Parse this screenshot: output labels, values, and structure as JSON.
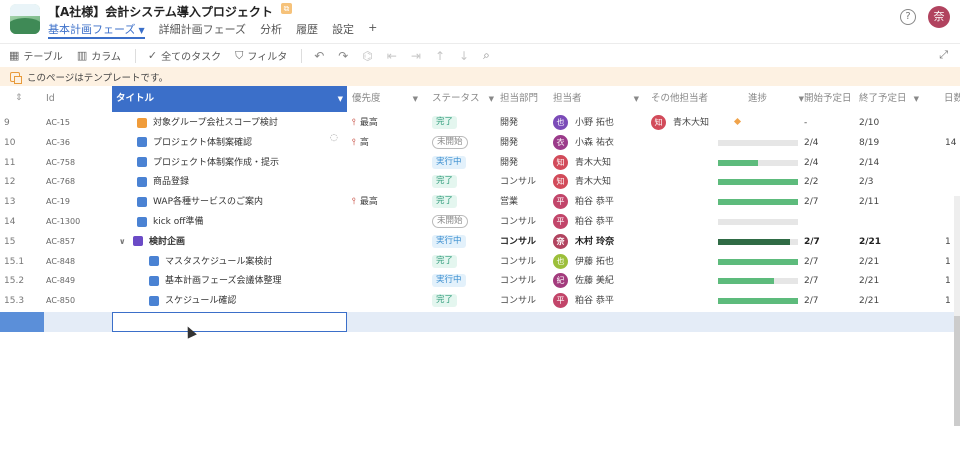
{
  "header": {
    "project_title": "【A社様】会計システム導入プロジェクト",
    "tabs": [
      {
        "label": "基本計画フェーズ",
        "active": true
      },
      {
        "label": "詳細計画フェーズ"
      },
      {
        "label": "分析"
      },
      {
        "label": "履歴"
      },
      {
        "label": "設定"
      },
      {
        "label": "+"
      }
    ],
    "help_icon": "?",
    "user_avatar": "奈"
  },
  "toolbar": {
    "table_label": "テーブル",
    "column_label": "カラム",
    "all_tasks_label": "全てのタスク",
    "filter_label": "フィルタ"
  },
  "notice": {
    "text": "このページはテンプレートです。"
  },
  "grid": {
    "columns": {
      "id": "Id",
      "title": "タイトル",
      "priority": "優先度",
      "status": "ステータス",
      "dept": "担当部門",
      "assignee": "担当者",
      "others": "その他担当者",
      "progress": "進捗",
      "start": "開始予定日",
      "end": "終了予定日",
      "days": "日数"
    },
    "rows": [
      {
        "num": "9",
        "id": "AC-15",
        "title": "対象グループ会社スコープ検討",
        "icon": "orange",
        "priority": "最高",
        "status": "完了",
        "status_type": "done",
        "dept": "開発",
        "assignee": "小野 拓也",
        "av": "也",
        "av_color": "#7b4bb8",
        "other": "青木大知",
        "other_av": "知",
        "other_color": "#d24b5a",
        "progress": null,
        "start": "-",
        "end": "2/10",
        "days": ""
      },
      {
        "num": "10",
        "id": "AC-36",
        "title": "プロジェクト体制案確認",
        "icon": "blue",
        "comment": true,
        "priority": "高",
        "status": "未開始",
        "status_type": "todo",
        "dept": "開発",
        "assignee": "小森 祐衣",
        "av": "衣",
        "av_color": "#9b3b8a",
        "progress": 0,
        "start": "2/4",
        "end": "8/19",
        "days": "14"
      },
      {
        "num": "11",
        "id": "AC-758",
        "title": "プロジェクト体制案作成・提示",
        "icon": "blue",
        "priority": "",
        "status": "実行中",
        "status_type": "prog",
        "dept": "開発",
        "assignee": "青木大知",
        "av": "知",
        "av_color": "#d24b5a",
        "progress": 0.5,
        "start": "2/4",
        "end": "2/14",
        "days": ""
      },
      {
        "num": "12",
        "id": "AC-768",
        "title": "商品登録",
        "icon": "blue",
        "priority": "",
        "status": "完了",
        "status_type": "done",
        "dept": "コンサル",
        "assignee": "青木大知",
        "av": "知",
        "av_color": "#d24b5a",
        "progress": 1,
        "start": "2/2",
        "end": "2/3",
        "days": ""
      },
      {
        "num": "13",
        "id": "AC-19",
        "title": "WAP各種サービスのご案内",
        "icon": "blue",
        "priority": "最高",
        "status": "完了",
        "status_type": "done",
        "dept": "営業",
        "assignee": "粕谷 恭平",
        "av": "平",
        "av_color": "#c2456a",
        "progress": 1,
        "start": "2/7",
        "end": "2/11",
        "days": ""
      },
      {
        "num": "14",
        "id": "AC-1300",
        "title": "kick off準備",
        "icon": "blue",
        "priority": "",
        "status": "未開始",
        "status_type": "todo",
        "dept": "コンサル",
        "assignee": "粕谷 恭平",
        "av": "平",
        "av_color": "#c2456a",
        "progress": 0,
        "start": "",
        "end": "",
        "days": ""
      },
      {
        "num": "15",
        "id": "AC-857",
        "title": "検討企画",
        "icon": "purple",
        "chevron": true,
        "bold": true,
        "priority": "",
        "status": "実行中",
        "status_type": "prog",
        "dept": "コンサル",
        "assignee": "木村 玲奈",
        "av": "奈",
        "av_color": "#b1435f",
        "progress": 0.9,
        "progress_dark": true,
        "start": "2/7",
        "end": "2/21",
        "days": "1"
      },
      {
        "num": "15.1",
        "id": "AC-848",
        "title": "マスタスケジュール案検討",
        "icon": "blue",
        "indent": true,
        "priority": "",
        "status": "完了",
        "status_type": "done",
        "dept": "コンサル",
        "assignee": "伊藤 拓也",
        "av": "也",
        "av_color": "#9cbf3a",
        "progress": 1,
        "start": "2/7",
        "end": "2/21",
        "days": "1"
      },
      {
        "num": "15.2",
        "id": "AC-849",
        "title": "基本計画フェーズ会議体整理",
        "icon": "blue",
        "indent": true,
        "priority": "",
        "status": "実行中",
        "status_type": "prog",
        "dept": "コンサル",
        "assignee": "佐藤 美紀",
        "av": "紀",
        "av_color": "#a33b7d",
        "progress": 0.7,
        "start": "2/7",
        "end": "2/21",
        "days": "1"
      },
      {
        "num": "15.3",
        "id": "AC-850",
        "title": "スケジュール確認",
        "icon": "blue",
        "indent": true,
        "priority": "",
        "status": "完了",
        "status_type": "done",
        "dept": "コンサル",
        "assignee": "粕谷 恭平",
        "av": "平",
        "av_color": "#c2456a",
        "progress": 1,
        "start": "2/7",
        "end": "2/21",
        "days": "1"
      }
    ]
  }
}
